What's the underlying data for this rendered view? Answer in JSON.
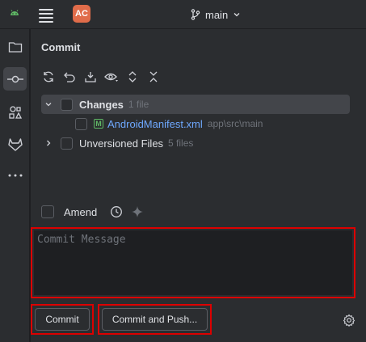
{
  "titlebar": {
    "avatar_text": "AC",
    "branch_label": "main",
    "icons": [
      "android-icon",
      "hamburger-menu-icon",
      "branch-icon",
      "chevron-down-icon"
    ]
  },
  "toolstrip": {
    "items": [
      "folder-icon",
      "commit-icon",
      "structure-icon",
      "gitlab-icon",
      "more-icon"
    ],
    "active": "commit-icon"
  },
  "commit_panel": {
    "title": "Commit",
    "toolbar_icons": [
      "refresh-icon",
      "rollback-icon",
      "shelve-icon",
      "preview-diff-icon",
      "expand-all-icon",
      "collapse-all-icon"
    ],
    "changes": {
      "label": "Changes",
      "count": "1 file",
      "files": [
        {
          "name": "AndroidManifest.xml",
          "path": "app\\src\\main",
          "badge": "M"
        }
      ]
    },
    "unversioned": {
      "label": "Unversioned Files",
      "count": "5 files"
    },
    "amend_label": "Amend",
    "message_placeholder": "Commit Message",
    "commit_button": "Commit",
    "commit_push_button": "Commit and Push..."
  },
  "colors": {
    "accent_link": "#6ea8fe",
    "avatar_bg": "#e06c4a",
    "highlight_outline": "#dd0000"
  }
}
